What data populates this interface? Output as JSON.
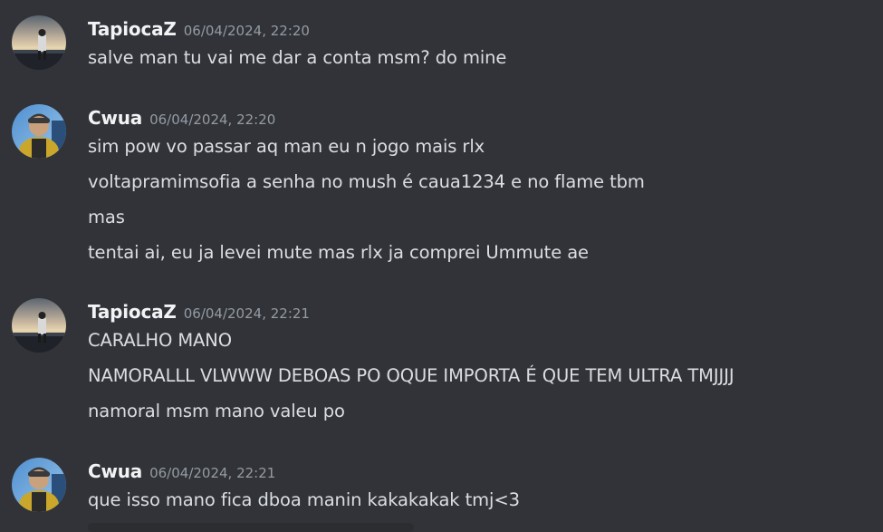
{
  "messages": [
    {
      "username": "TapiocaZ",
      "timestamp": "06/04/2024, 22:20",
      "avatar_icon": "avatar-tapiocaz-icon",
      "lines": [
        "salve man tu vai me dar a conta msm? do mine"
      ]
    },
    {
      "username": "Cwua",
      "timestamp": "06/04/2024, 22:20",
      "avatar_icon": "avatar-cwua-icon",
      "lines": [
        "sim pow vo passar aq man eu n jogo mais rlx",
        "voltapramimsofia a senha no mush é caua1234 e no flame tbm",
        "mas",
        "tentai ai, eu ja levei mute mas rlx ja comprei Ummute ae"
      ]
    },
    {
      "username": "TapiocaZ",
      "timestamp": "06/04/2024, 22:21",
      "avatar_icon": "avatar-tapiocaz-icon",
      "lines": [
        "CARALHO MANO",
        "NAMORALLL VLWWW DEBOAS PO OQUE IMPORTA É QUE TEM ULTRA TMJJJJ",
        "namoral msm mano valeu po"
      ]
    },
    {
      "username": "Cwua",
      "timestamp": "06/04/2024, 22:21",
      "avatar_icon": "avatar-cwua-icon",
      "lines": [
        "que isso mano fica dboa manin kakakakak tmj<3"
      ]
    }
  ],
  "colors": {
    "background": "#313338",
    "username": "#f2f3f5",
    "timestamp": "#949ba4",
    "text": "#dbdee1"
  }
}
